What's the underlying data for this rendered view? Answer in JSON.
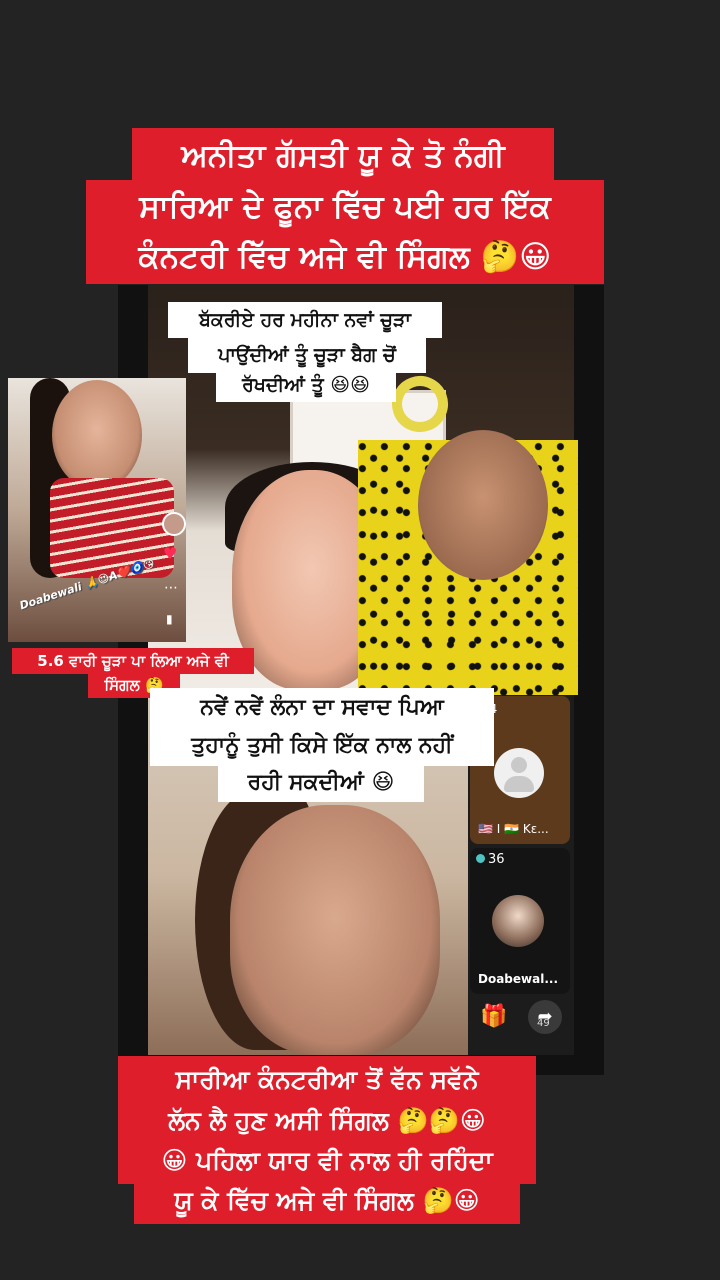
{
  "captions": {
    "top": [
      "ਅਨੀਤਾ ਗੱਸਤੀ ਯੂ ਕੇ ਤੋ  ਨੰਗੀ",
      "ਸਾਰਿਆ ਦੇ ਫੂਨਾ ਵਿੱਚ ਪਈ ਹਰ ਇੱਕ",
      "ਕੰਨਟਰੀ ਵਿੱਚ ਅਜੇ ਵੀ ਸਿੰਗਲ 🤔😀"
    ],
    "bakri": [
      "ਬੱਕਰੀਏ ਹਰ ਮਹੀਨਾ ਨਵਾਂ ਚੂੜਾ",
      "ਪਾਉਂਦੀਆਂ ਤੂੰ ਚੂੜਾ ਬੈਗ ਚੋਂ",
      "ਰੱਖਦੀਆਂ ਤੂੰ 😆😆"
    ],
    "inset": [
      "5.6 ਵਾਰੀ ਚੂੜਾ ਪਾ ਲਿਆ ਅਜੇ ਵੀ",
      "ਸਿੰਗਲ 🤔"
    ],
    "middle": [
      "ਨਵੇਂ ਨਵੇਂ ਲੰਨਾ ਦਾ ਸਵਾਦ ਪਿਆ",
      "ਤੁਹਾਨੂੰ ਤੁਸੀ ਕਿਸੇ ਇੱਕ ਨਾਲ ਨਹੀਂ",
      "ਰਹੀ ਸਕਦੀਆਂ 😆"
    ],
    "bottom": [
      "ਸਾਰੀਆ ਕੰਨਟਰੀਆ ਤੋਂ ਵੱਨ ਸਵੱਨੇ",
      "ਲੱਨ ਲੈ ਹੁਣ ਅਸੀ ਸਿੰਗਲ 🤔🤔😀",
      "😀 ਪਹਿਲਾ ਯਾਰ ਵੀ ਨਾਲ ਹੀ ਰਹਿੰਦਾ",
      "ਯੂ ਕੇ ਵਿੱਚ ਅਜੇ ਵੀ ਸਿੰਗਲ 🤔😀"
    ]
  },
  "inset_watermark": "Doabewali 🙏😍A❤️🧿😘",
  "live": {
    "guest_count": "44",
    "guest_name": "🇺🇸 I 🇮🇳 Kɛ...",
    "host_count": "36",
    "host_name": "Doabewal...",
    "share_count": "49",
    "gift_icon": "gift-icon",
    "share_icon": "share-icon"
  },
  "colors": {
    "caption_red": "#de1f2b",
    "caption_white": "#ffffff",
    "background": "#232323"
  }
}
